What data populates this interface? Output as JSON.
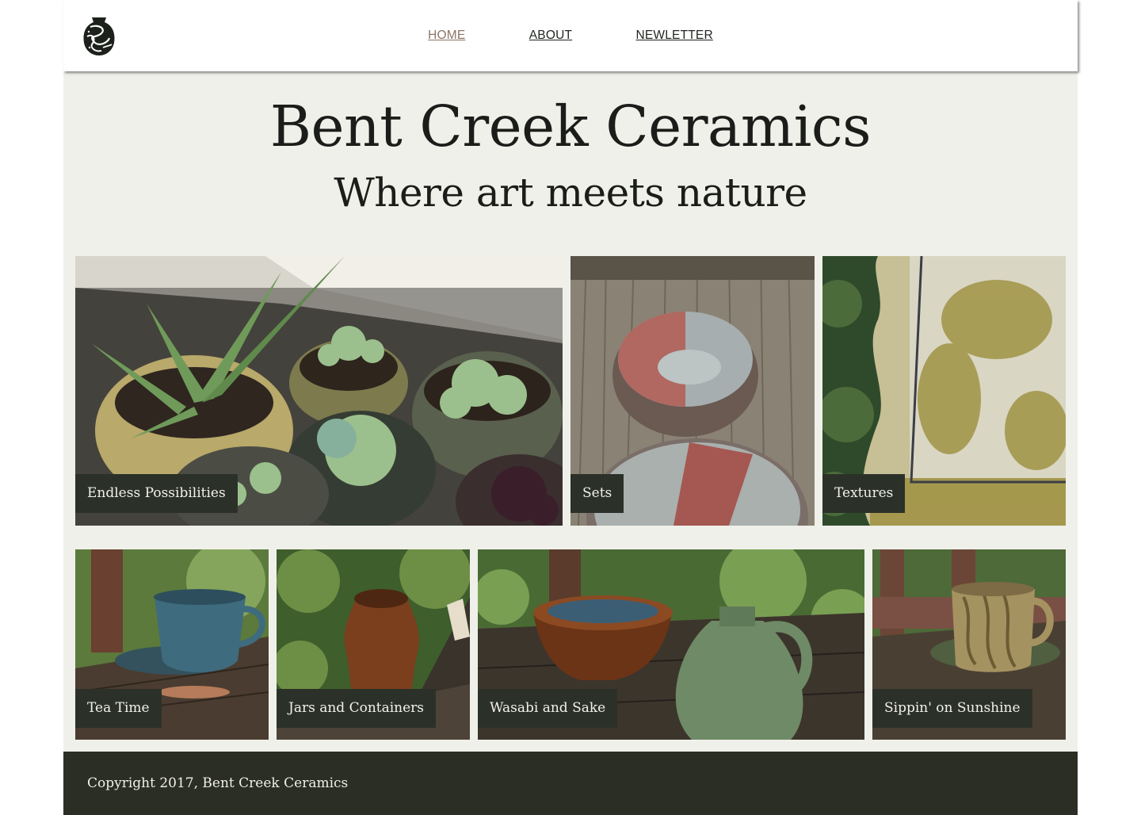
{
  "site": {
    "logo_icon": "pottery-vase-logo-icon"
  },
  "nav": {
    "items": [
      {
        "label": "HOME",
        "active": true
      },
      {
        "label": "ABOUT",
        "active": false
      },
      {
        "label": "NEWLETTER",
        "active": false
      }
    ]
  },
  "hero": {
    "title": "Bent Creek Ceramics",
    "subtitle": "Where art meets nature"
  },
  "gallery": {
    "row1": [
      {
        "label": "Endless Possibilities"
      },
      {
        "label": "Sets"
      },
      {
        "label": "Textures"
      }
    ],
    "row2": [
      {
        "label": "Tea Time"
      },
      {
        "label": "Jars and Containers"
      },
      {
        "label": "Wasabi and Sake"
      },
      {
        "label": "Sippin' on Sunshine"
      }
    ]
  },
  "footer": {
    "copyright": "Copyright 2017, Bent Creek Ceramics"
  },
  "colors": {
    "background": "#f0f0ea",
    "caption_bg": "#2b3129",
    "footer_bg": "#2a2e25",
    "nav_active": "#8c7565"
  }
}
